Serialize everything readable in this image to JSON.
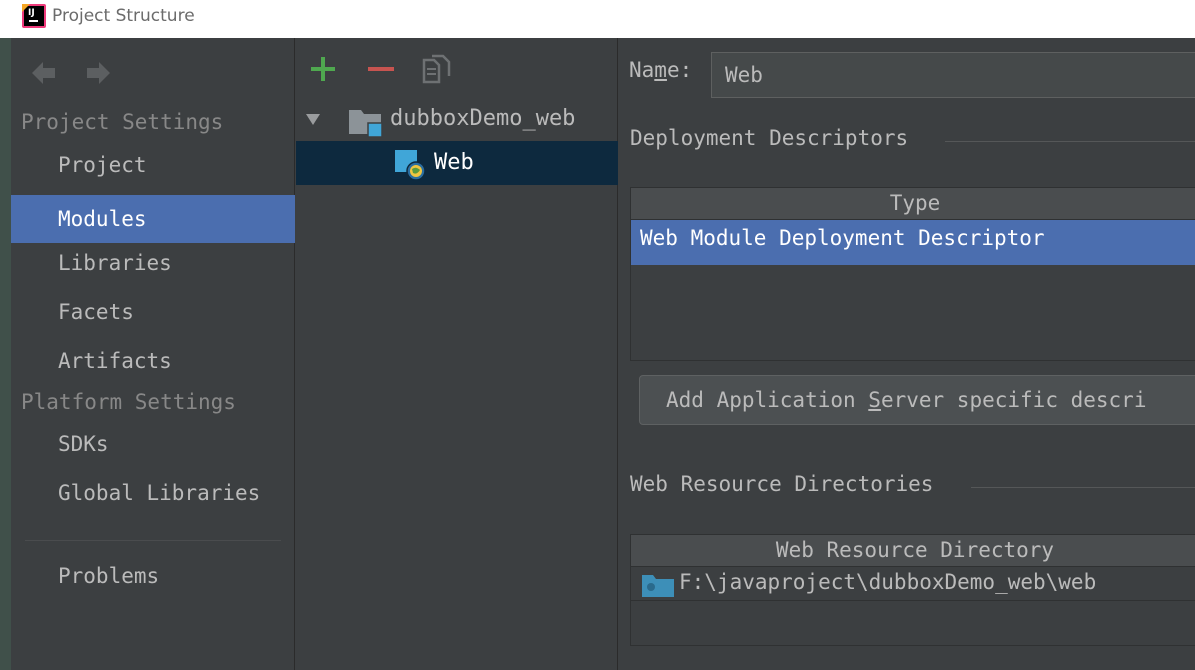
{
  "window": {
    "title": "Project Structure"
  },
  "sidebar": {
    "project_settings_header": "Project Settings",
    "platform_settings_header": "Platform Settings",
    "items": [
      {
        "label": "Project",
        "selected": false
      },
      {
        "label": "Modules",
        "selected": true
      },
      {
        "label": "Libraries",
        "selected": false
      },
      {
        "label": "Facets",
        "selected": false
      },
      {
        "label": "Artifacts",
        "selected": false
      },
      {
        "label": "SDKs",
        "selected": false
      },
      {
        "label": "Global Libraries",
        "selected": false
      },
      {
        "label": "Problems",
        "selected": false
      }
    ]
  },
  "tree": {
    "root_label": "dubboxDemo_web",
    "child_label": "Web"
  },
  "detail": {
    "name_label_pre": "Na",
    "name_label_mnemonic": "m",
    "name_label_post": "e:",
    "name_value": "Web",
    "deployment_title": "Deployment Descriptors",
    "dd_column": "Type",
    "dd_rows": [
      "Web Module Deployment Descriptor"
    ],
    "add_server_pre": "Add Application ",
    "add_server_mnemonic": "S",
    "add_server_post": "erver specific descri",
    "web_resource_title": "Web Resource Directories",
    "wr_column": "Web Resource Directory",
    "wr_rows": [
      "F:\\javaproject\\dubboxDemo_web\\web"
    ]
  },
  "colors": {
    "selection": "#4b6eaf",
    "tree_selection": "#0d293e",
    "background": "#3c3f41",
    "add": "#4fa84f",
    "remove": "#c75450"
  }
}
